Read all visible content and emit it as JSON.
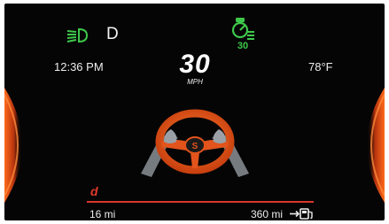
{
  "indicators": {
    "headlight_icon": "low-beam-headlight-icon",
    "gear": "D",
    "cruise_icon": "adaptive-cruise-control-icon",
    "cruise_set_speed": "30"
  },
  "top_row": {
    "time": "12:36 PM",
    "outside_temperature": "78°F"
  },
  "speedometer": {
    "speed": "30",
    "unit": "MPH"
  },
  "center_graphic": "steering-wheel-assist-icon",
  "bottom_row": {
    "drive_mode": "d",
    "trip_distance": "16 mi",
    "range_to_empty": "360 mi",
    "fuel_icon": "fuel-range-icon"
  },
  "colors": {
    "background": "#050505",
    "accent_orange": "#e2541c",
    "indicator_green": "#3ec84b",
    "mode_red": "#e53a2b",
    "hand_gray": "#8b9096"
  }
}
